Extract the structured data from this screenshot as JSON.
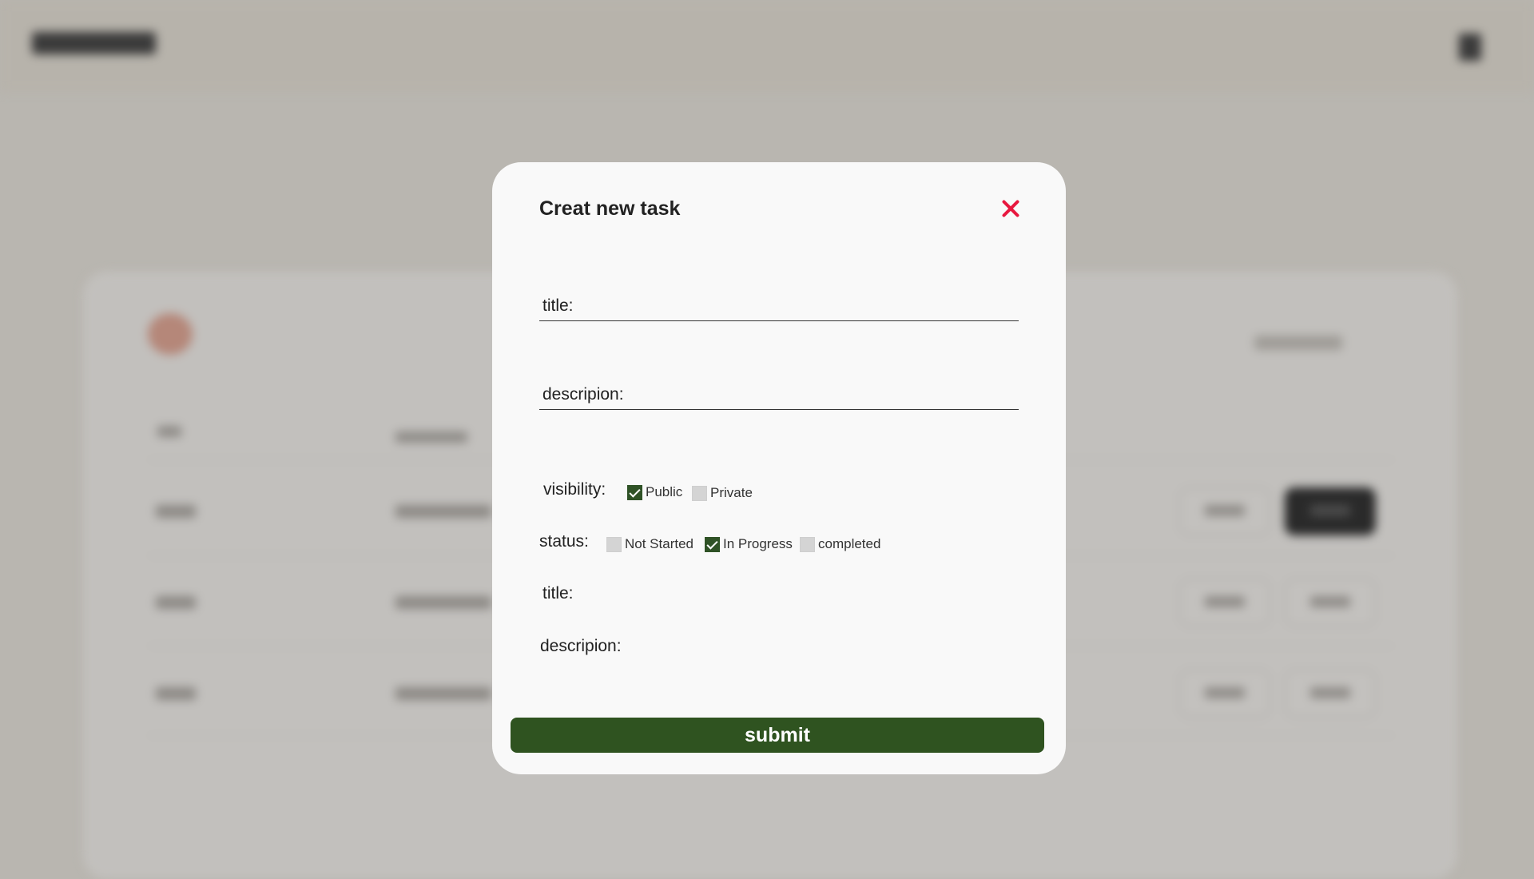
{
  "modal": {
    "title": "Creat new task",
    "title_field_label": "title:",
    "description_field_label": "descripion:",
    "visibility": {
      "label": "visibility:",
      "options": [
        {
          "label": "Public",
          "checked": true
        },
        {
          "label": "Private",
          "checked": false
        }
      ]
    },
    "status": {
      "label": "status:",
      "options": [
        {
          "label": "Not Started",
          "checked": false
        },
        {
          "label": "In Progress",
          "checked": true
        },
        {
          "label": "completed",
          "checked": false
        }
      ]
    },
    "preview_title_label": "title:",
    "preview_description_label": "descripion:",
    "submit_label": "submit"
  },
  "colors": {
    "accent_green": "#2f5320",
    "close_red": "#e8183f",
    "modal_bg": "#f9f9f9"
  }
}
